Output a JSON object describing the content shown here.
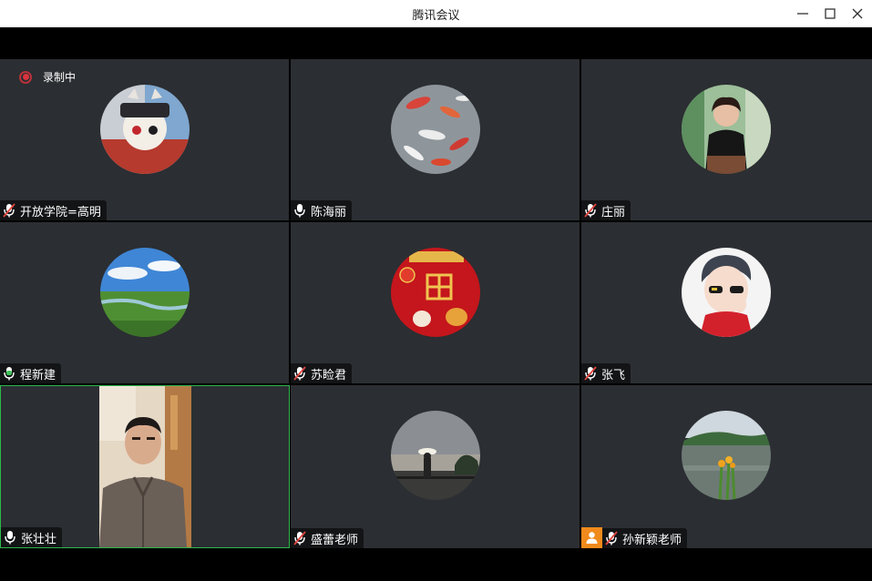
{
  "window": {
    "title": "腾讯会议"
  },
  "recording": {
    "label": "录制中"
  },
  "participants": [
    {
      "name": "开放学院=高明",
      "mic": "muted",
      "avatar": "anime-character-avatar"
    },
    {
      "name": "陈海丽",
      "mic": "on",
      "avatar": "koi-fish-pond-avatar"
    },
    {
      "name": "庄丽",
      "mic": "muted",
      "avatar": "woman-portrait-avatar"
    },
    {
      "name": "程新建",
      "mic": "speaking",
      "avatar": "grassland-landscape-avatar"
    },
    {
      "name": "苏睑君",
      "mic": "muted",
      "avatar": "red-new-year-poster-avatar"
    },
    {
      "name": "张飞",
      "mic": "muted",
      "avatar": "illustrated-boy-with-sunglasses-avatar"
    },
    {
      "name": "张壮壮",
      "mic": "on",
      "video": "camera-feed-man-in-hoodie",
      "active": true
    },
    {
      "name": "盛蕾老师",
      "mic": "muted",
      "avatar": "sunset-seaside-avatar"
    },
    {
      "name": "孙新颖老师",
      "mic": "muted",
      "avatar": "lake-flowers-avatar",
      "host": true
    }
  ],
  "colors": {
    "tile_bg": "#2b2e32",
    "active_border": "#2db84d",
    "muted_red": "#e0463f",
    "speaking_green": "#3fc25a",
    "host_orange": "#f08a1c"
  }
}
